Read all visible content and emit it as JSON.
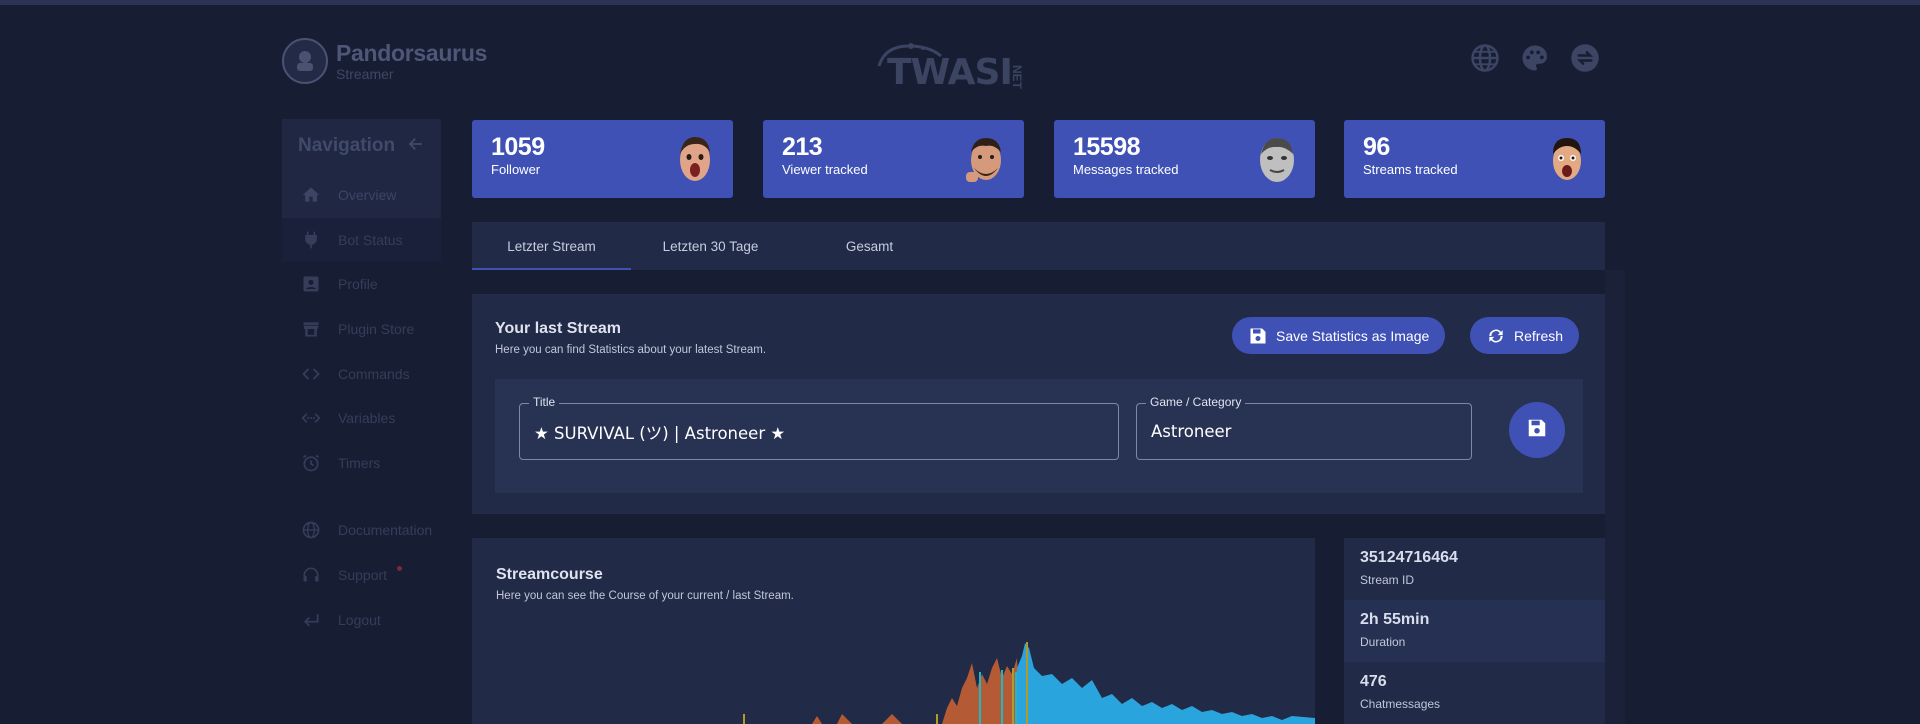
{
  "header": {
    "user_name": "Pandorsaurus",
    "user_role": "Streamer",
    "logo_text": "TWASI",
    "logo_suffix": "NET",
    "icons": [
      "globe-icon",
      "palette-icon",
      "swap-icon"
    ]
  },
  "sidebar": {
    "title": "Navigation",
    "items": [
      {
        "label": "Overview",
        "icon": "home-icon"
      },
      {
        "label": "Bot Status",
        "icon": "plug-icon"
      },
      {
        "label": "Profile",
        "icon": "account-box-icon"
      },
      {
        "label": "Plugin Store",
        "icon": "store-icon"
      },
      {
        "label": "Commands",
        "icon": "code-icon"
      },
      {
        "label": "Variables",
        "icon": "code-dots-icon"
      },
      {
        "label": "Timers",
        "icon": "alarm-icon"
      }
    ],
    "bottom_items": [
      {
        "label": "Documentation",
        "icon": "globe-icon"
      },
      {
        "label": "Support",
        "icon": "headset-icon"
      },
      {
        "label": "Logout",
        "icon": "logout-icon"
      }
    ]
  },
  "stats": [
    {
      "value": "1059",
      "label": "Follower"
    },
    {
      "value": "213",
      "label": "Viewer tracked"
    },
    {
      "value": "15598",
      "label": "Messages tracked"
    },
    {
      "value": "96",
      "label": "Streams tracked"
    }
  ],
  "tabs": [
    "Letzter Stream",
    "Letzten 30 Tage",
    "Gesamt"
  ],
  "last_stream": {
    "title": "Your last Stream",
    "subtitle": "Here you can find Statistics about your latest Stream.",
    "save_image_label": "Save Statistics as Image",
    "refresh_label": "Refresh",
    "title_field_label": "Title",
    "title_value": "★ SURVIVAL (ツ) | Astroneer ★",
    "game_field_label": "Game / Category",
    "game_value": "Astroneer"
  },
  "streamcourse": {
    "title": "Streamcourse",
    "subtitle": "Here you can see the Course of your current / last Stream."
  },
  "stream_info": [
    {
      "value": "35124716464",
      "label": "Stream ID"
    },
    {
      "value": "2h 55min",
      "label": "Duration"
    },
    {
      "value": "476",
      "label": "Chatmessages"
    }
  ],
  "colors": {
    "background": "#171d33",
    "card": "#212a46",
    "accent": "#3f51b5",
    "chart_orange": "#c0623a",
    "chart_blue": "#29a8e0",
    "chart_yellow": "#b59a2a",
    "chart_cyan": "#1fb8c7"
  }
}
